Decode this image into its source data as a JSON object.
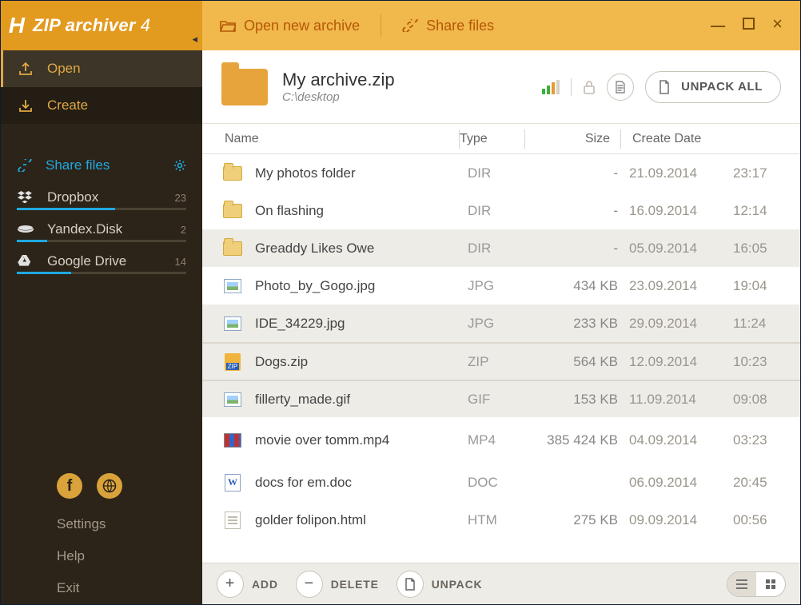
{
  "brand": {
    "logo": "H",
    "name": "ZIP archiver",
    "version": "4"
  },
  "menubar": {
    "open_new_archive": "Open new archive",
    "share_files": "Share files"
  },
  "sidebar": {
    "collapse_glyph": "◂",
    "open": "Open",
    "create": "Create",
    "share_files": "Share files",
    "clouds": [
      {
        "name": "Dropbox",
        "count": "23",
        "pct": 58
      },
      {
        "name": "Yandex.Disk",
        "count": "2",
        "pct": 18
      },
      {
        "name": "Google Drive",
        "count": "14",
        "pct": 32
      }
    ],
    "links": {
      "settings": "Settings",
      "help": "Help",
      "exit": "Exit"
    }
  },
  "header": {
    "title": "My archive.zip",
    "path": "C:\\desktop",
    "unpack_all": "UNPACK ALL"
  },
  "columns": {
    "name": "Name",
    "type": "Type",
    "size": "Size",
    "date": "Create Date"
  },
  "files": [
    {
      "icon": "folder",
      "name": "My photos folder",
      "type": "DIR",
      "size": "-",
      "date": "21.09.2014",
      "time": "23:17",
      "alt": false
    },
    {
      "icon": "folder",
      "name": "On flashing",
      "type": "DIR",
      "size": "-",
      "date": "16.09.2014",
      "time": "12:14",
      "alt": false
    },
    {
      "icon": "folder",
      "name": "Greaddy Likes Owe",
      "type": "DIR",
      "size": "-",
      "date": "05.09.2014",
      "time": "16:05",
      "alt": true
    },
    {
      "icon": "img",
      "name": "Photo_by_Gogo.jpg",
      "type": "JPG",
      "size": "434 KB",
      "date": "23.09.2014",
      "time": "19:04",
      "alt": false
    },
    {
      "icon": "img",
      "name": "IDE_34229.jpg",
      "type": "JPG",
      "size": "233 KB",
      "date": "29.09.2014",
      "time": "11:24",
      "alt": true
    },
    {
      "icon": "zip",
      "name": "Dogs.zip",
      "type": "ZIP",
      "size": "564 KB",
      "date": "12.09.2014",
      "time": "10:23",
      "alt": true,
      "sepAbove": true
    },
    {
      "icon": "img",
      "name": "fillerty_made.gif",
      "type": "GIF",
      "size": "153 KB",
      "date": "11.09.2014",
      "time": "09:08",
      "alt": true,
      "sepAbove": true
    },
    {
      "icon": "vid",
      "name": "movie over tomm.mp4",
      "type": "MP4",
      "size": "385 424 KB",
      "date": "04.09.2014",
      "time": "03:23",
      "alt": false,
      "tall": true
    },
    {
      "icon": "doc",
      "name": "docs for em.doc",
      "type": "DOC",
      "size": "",
      "date": "06.09.2014",
      "time": "20:45",
      "alt": false
    },
    {
      "icon": "htm",
      "name": "golder folipon.html",
      "type": "HTM",
      "size": "275 KB",
      "date": "09.09.2014",
      "time": "00:56",
      "alt": false
    }
  ],
  "footer": {
    "add": "ADD",
    "delete": "DELETE",
    "unpack": "UNPACK"
  }
}
